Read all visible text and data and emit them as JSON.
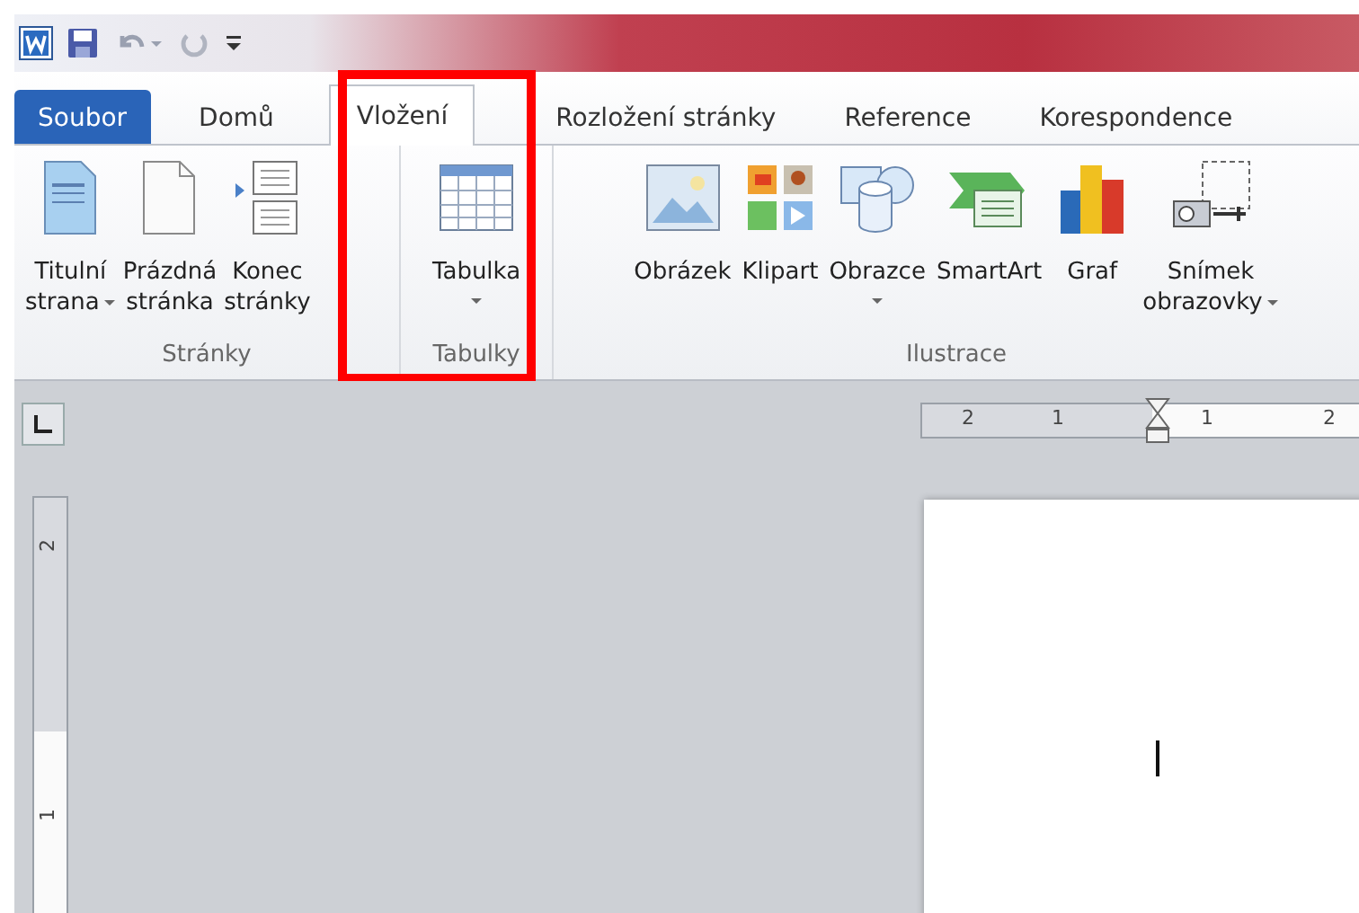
{
  "tabs": [
    {
      "label": "Soubor",
      "kind": "file",
      "selected": false
    },
    {
      "label": "Domů",
      "kind": "tab",
      "selected": false
    },
    {
      "label": "Vložení",
      "kind": "tab",
      "selected": true
    },
    {
      "label": "Rozložení stránky",
      "kind": "tab",
      "selected": false
    },
    {
      "label": "Reference",
      "kind": "tab",
      "selected": false
    },
    {
      "label": "Korespondence",
      "kind": "tab",
      "selected": false
    }
  ],
  "ribbon": {
    "groups": [
      {
        "label": "Stránky",
        "commands": [
          {
            "lines": [
              "Titulní",
              "strana"
            ],
            "kind": "cover",
            "dropdown": true
          },
          {
            "lines": [
              "Prázdná",
              "stránka"
            ],
            "kind": "blank",
            "dropdown": false
          },
          {
            "lines": [
              "Konec",
              "stránky"
            ],
            "kind": "break",
            "dropdown": false
          }
        ]
      },
      {
        "label": "Tabulky",
        "commands": [
          {
            "lines": [
              "Tabulka"
            ],
            "kind": "table",
            "dropdown": true
          }
        ]
      },
      {
        "label": "Ilustrace",
        "commands": [
          {
            "lines": [
              "Obrázek"
            ],
            "kind": "picture",
            "dropdown": false
          },
          {
            "lines": [
              "Klipart"
            ],
            "kind": "clipart",
            "dropdown": false
          },
          {
            "lines": [
              "Obrazce"
            ],
            "kind": "shapes",
            "dropdown": true
          },
          {
            "lines": [
              "SmartArt"
            ],
            "kind": "smartart",
            "dropdown": false
          },
          {
            "lines": [
              "Graf"
            ],
            "kind": "chart",
            "dropdown": false
          },
          {
            "lines": [
              "Snímek",
              "obrazovky"
            ],
            "kind": "screenshot",
            "dropdown": true
          }
        ]
      }
    ]
  },
  "horizontal_ruler": {
    "labels": [
      "2",
      "1",
      "1",
      "2"
    ]
  },
  "vertical_ruler": {
    "labels": [
      "2",
      "1"
    ]
  }
}
